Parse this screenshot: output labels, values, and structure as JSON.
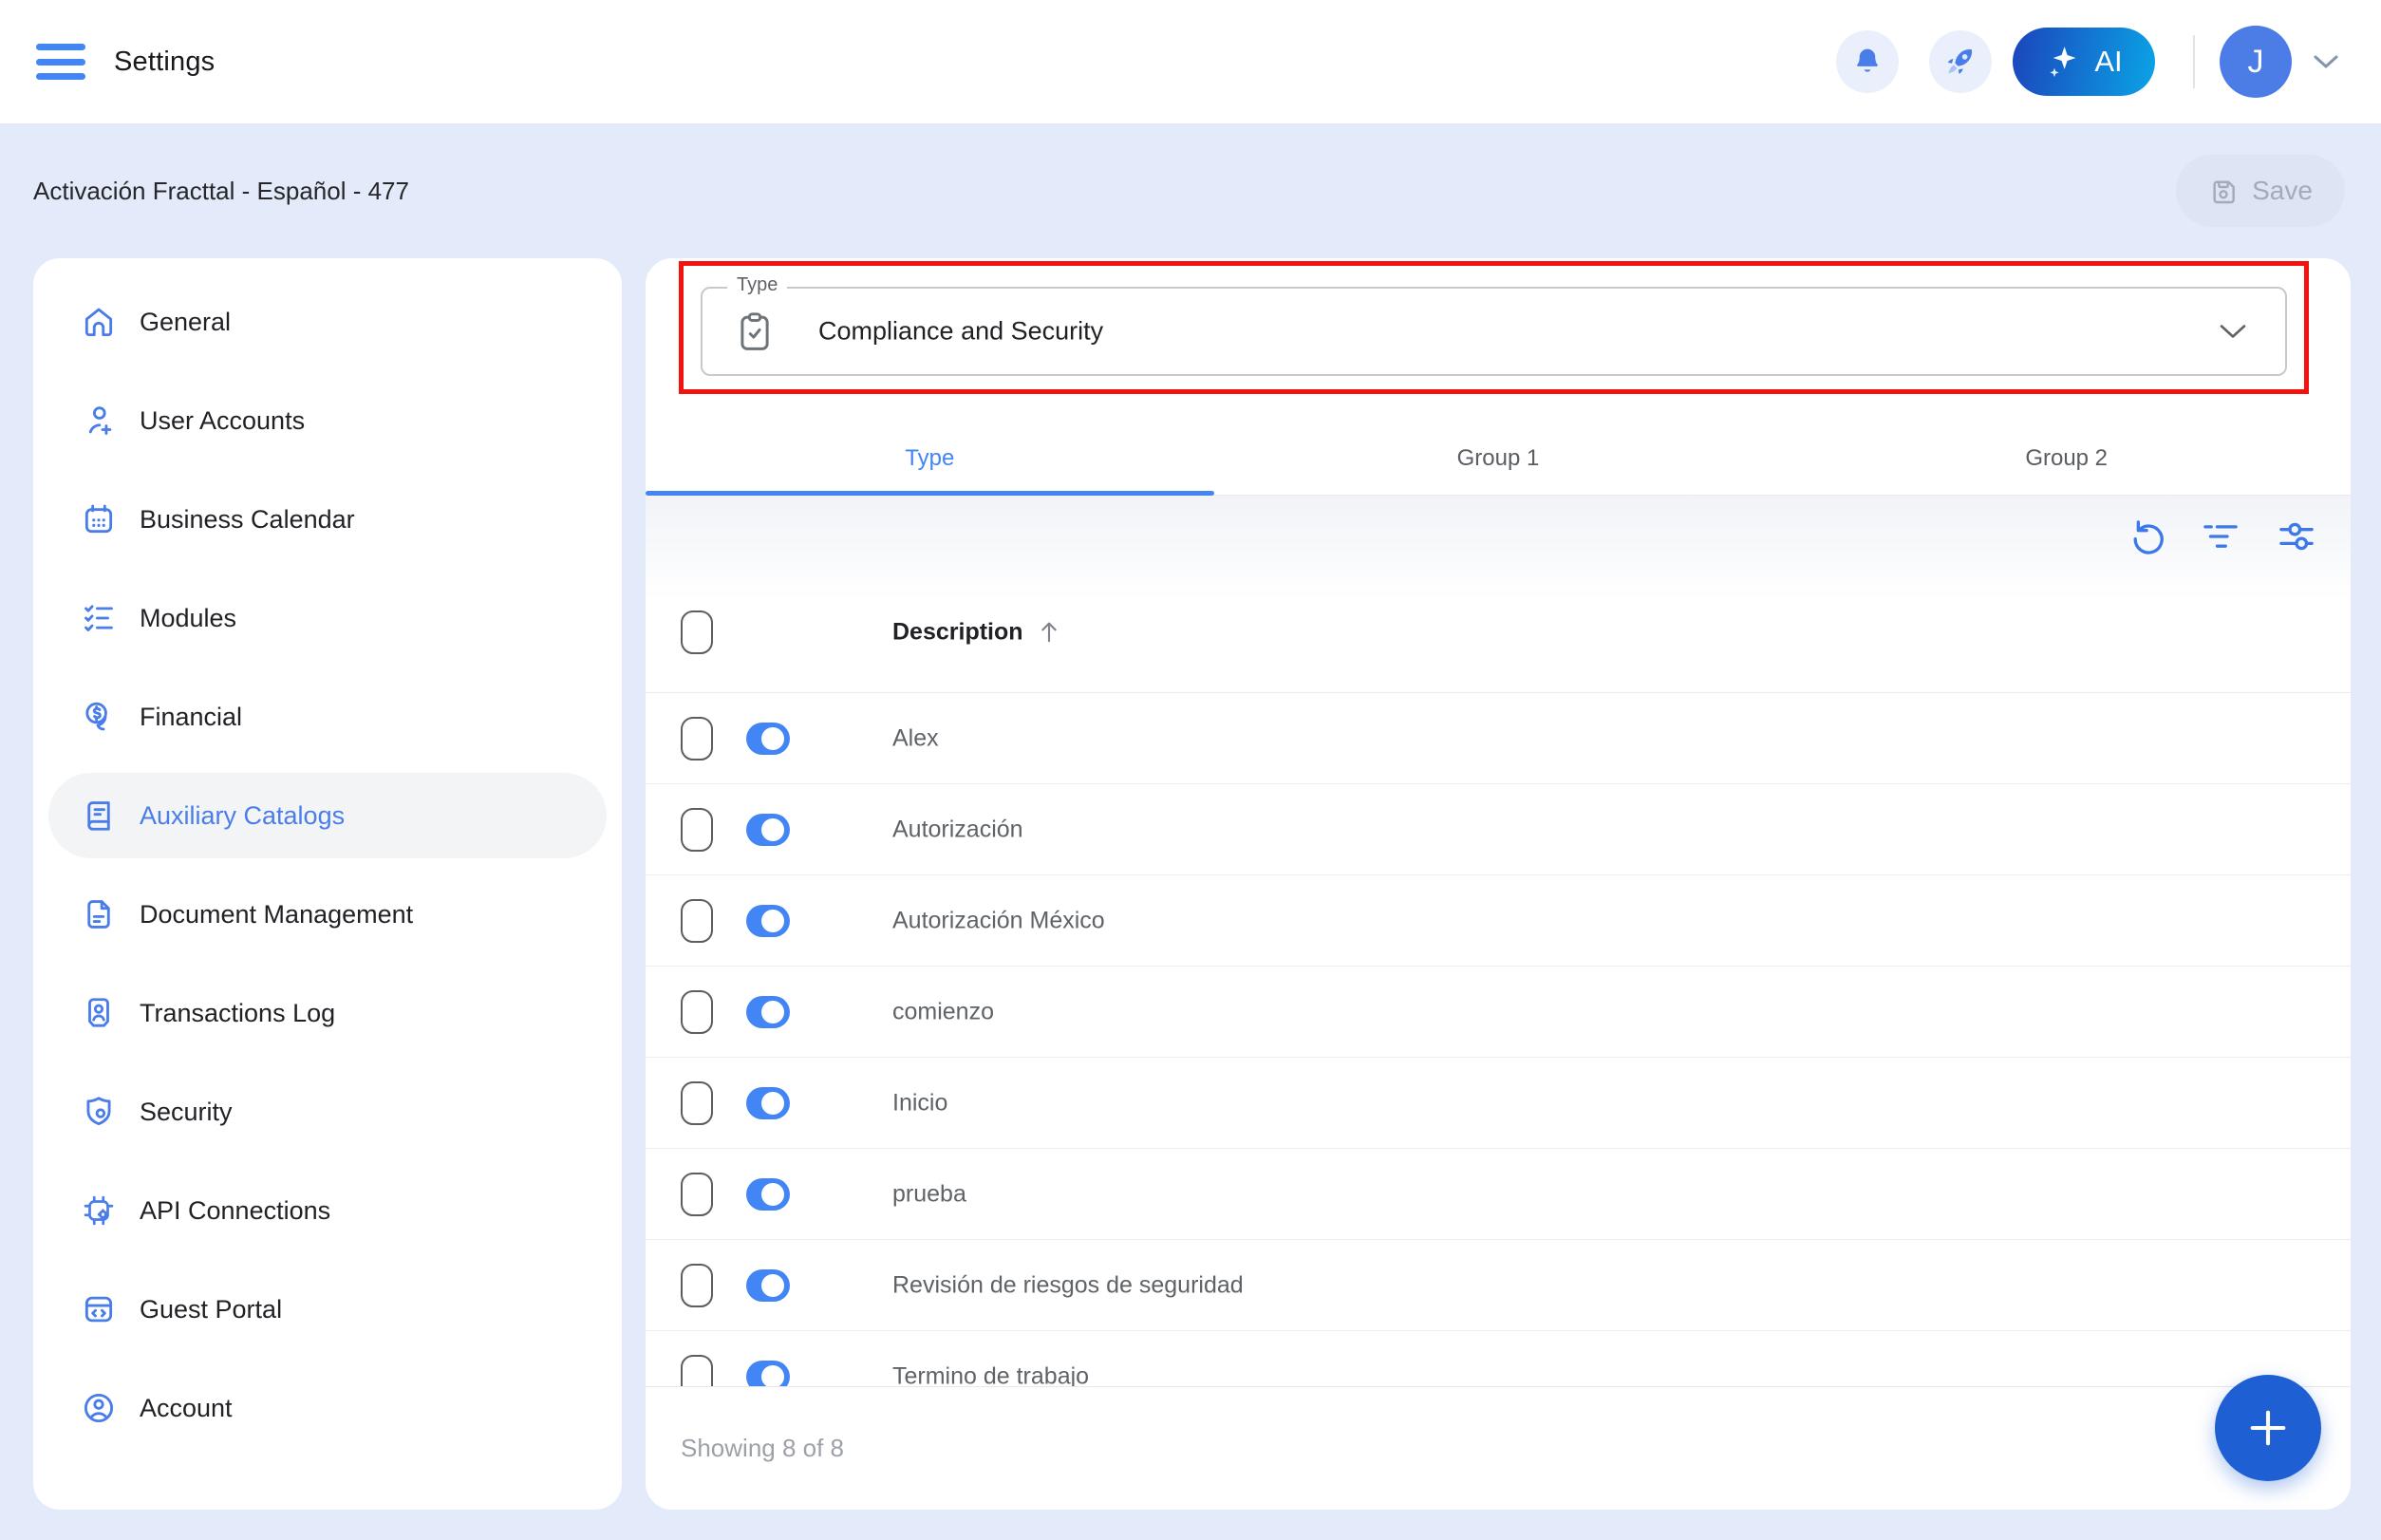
{
  "topbar": {
    "title": "Settings",
    "ai_button_label": "AI",
    "avatar_initial": "J",
    "icons": [
      "menu-icon",
      "bell-icon",
      "rocket-icon",
      "sparkle-icon",
      "chevron-down-icon"
    ]
  },
  "band": {
    "title": "Activación Fracttal - Español - 477",
    "save_label": "Save"
  },
  "sidebar": {
    "items": [
      {
        "label": "General",
        "icon": "home-icon",
        "active": false
      },
      {
        "label": "User Accounts",
        "icon": "user-add-icon",
        "active": false
      },
      {
        "label": "Business Calendar",
        "icon": "calendar-icon",
        "active": false
      },
      {
        "label": "Modules",
        "icon": "checklist-icon",
        "active": false
      },
      {
        "label": "Financial",
        "icon": "coin-icon",
        "active": false
      },
      {
        "label": "Auxiliary Catalogs",
        "icon": "catalog-book-icon",
        "active": true
      },
      {
        "label": "Document Management",
        "icon": "document-icon",
        "active": false
      },
      {
        "label": "Transactions Log",
        "icon": "transactions-icon",
        "active": false
      },
      {
        "label": "Security",
        "icon": "shield-icon",
        "active": false
      },
      {
        "label": "API Connections",
        "icon": "api-chip-icon",
        "active": false
      },
      {
        "label": "Guest Portal",
        "icon": "guest-portal-icon",
        "active": false
      },
      {
        "label": "Account",
        "icon": "account-icon",
        "active": false
      }
    ]
  },
  "main": {
    "type_field": {
      "label": "Type",
      "value": "Compliance and Security",
      "icon": "clipboard-check-icon",
      "highlighted": true
    },
    "tabs": [
      {
        "label": "Type",
        "active": true
      },
      {
        "label": "Group 1",
        "active": false
      },
      {
        "label": "Group 2",
        "active": false
      }
    ],
    "toolbar_icons": [
      "refresh-icon",
      "filter-icon",
      "adjust-icon"
    ],
    "table": {
      "header": {
        "description": "Description",
        "sort": "ascending"
      },
      "rows": [
        {
          "description": "Alex",
          "enabled": true,
          "selected": false
        },
        {
          "description": "Autorización",
          "enabled": true,
          "selected": false
        },
        {
          "description": "Autorización México",
          "enabled": true,
          "selected": false
        },
        {
          "description": "comienzo",
          "enabled": true,
          "selected": false
        },
        {
          "description": "Inicio",
          "enabled": true,
          "selected": false
        },
        {
          "description": "prueba",
          "enabled": true,
          "selected": false
        },
        {
          "description": "Revisión de riesgos de seguridad",
          "enabled": true,
          "selected": false
        },
        {
          "description": "Termino de trabajo",
          "enabled": true,
          "selected": false
        }
      ]
    },
    "footer": {
      "summary": "Showing 8 of 8"
    }
  },
  "colors": {
    "accent_blue": "#4285F4",
    "icon_blue": "#4A7DE8",
    "fab_blue": "#1E5FD3",
    "highlight_red": "#F2120E",
    "band_background": "#E3EBFA",
    "avatar_background": "#4C7CE5",
    "ai_gradient_start": "#1B45BC",
    "ai_gradient_end": "#0AA4E6"
  }
}
